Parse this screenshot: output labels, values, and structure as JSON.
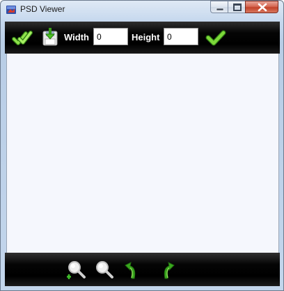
{
  "window": {
    "title": "PSD Viewer"
  },
  "toolbar": {
    "width_label": "Width",
    "width_value": "0",
    "height_label": "Height",
    "height_value": "0"
  },
  "icons": {
    "open": "double-checkmark-icon",
    "save": "save-download-icon",
    "apply": "checkmark-icon",
    "zoom_in": "zoom-in-icon",
    "zoom_out": "zoom-out-icon",
    "rotate_left": "rotate-left-icon",
    "rotate_right": "rotate-right-icon"
  },
  "colors": {
    "toolbar_bg": "#000000",
    "canvas_bg": "#f5f7fd",
    "accent_green": "#5cc21f",
    "close_button": "#c2432a"
  }
}
